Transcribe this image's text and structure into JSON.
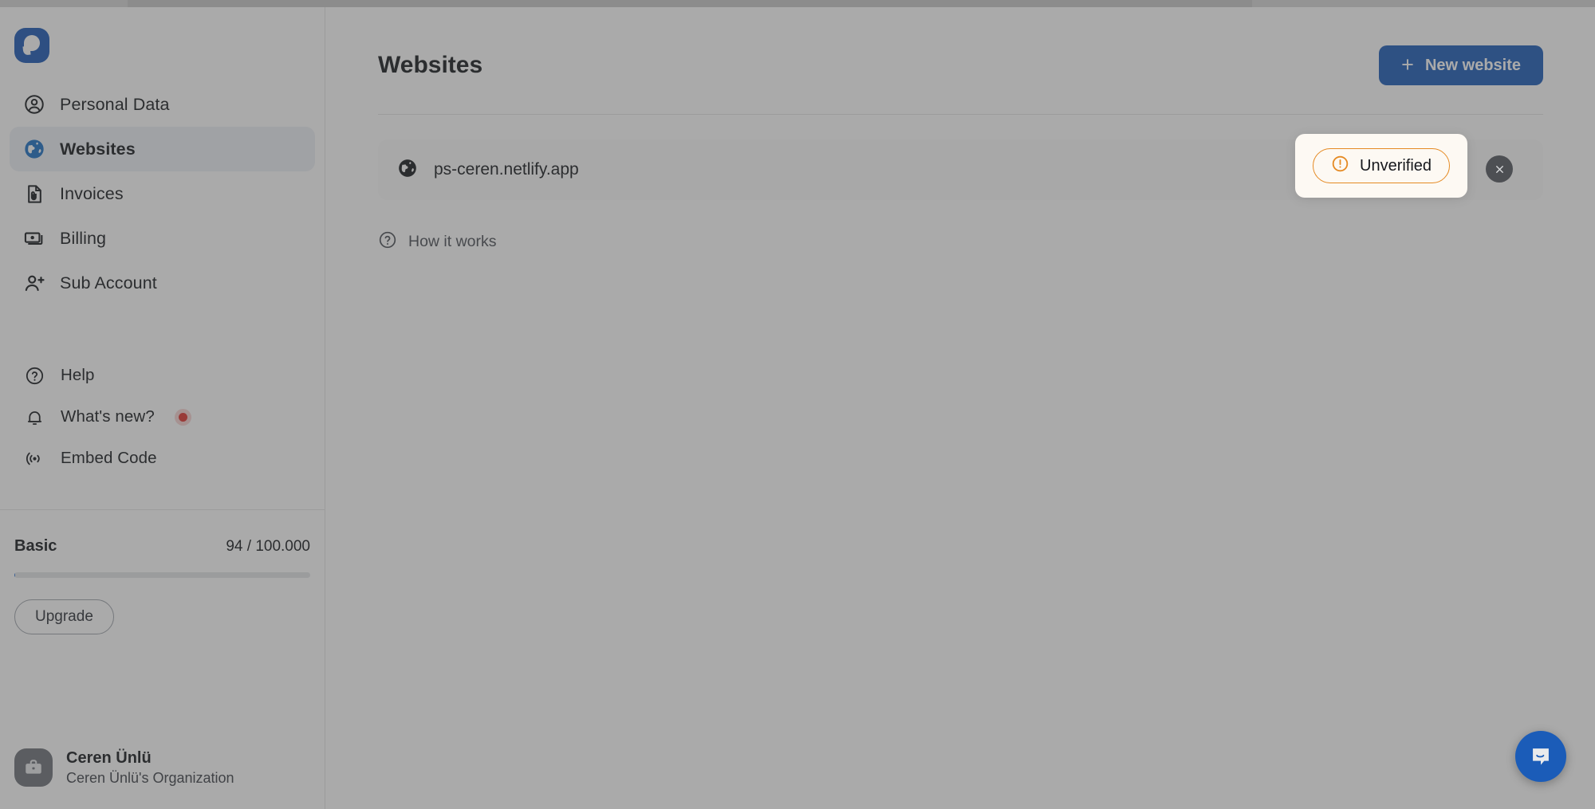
{
  "app": {
    "logo_name": "brand-logo"
  },
  "sidebar": {
    "primary_items": [
      {
        "label": "Personal Data",
        "icon": "user-circle-icon",
        "active": false
      },
      {
        "label": "Websites",
        "icon": "globe-icon",
        "active": true
      },
      {
        "label": "Invoices",
        "icon": "invoice-document-icon",
        "active": false
      },
      {
        "label": "Billing",
        "icon": "banknote-icon",
        "active": false
      },
      {
        "label": "Sub Account",
        "icon": "user-plus-icon",
        "active": false
      }
    ],
    "secondary_items": [
      {
        "label": "Help",
        "icon": "question-circle-icon",
        "badge": false
      },
      {
        "label": "What's new?",
        "icon": "bell-icon",
        "badge": true
      },
      {
        "label": "Embed Code",
        "icon": "broadcast-icon",
        "badge": false
      }
    ],
    "plan": {
      "name": "Basic",
      "usage": "94 / 100.000",
      "progress_percent": 0.094,
      "upgrade_label": "Upgrade"
    },
    "profile": {
      "name": "Ceren Ünlü",
      "organization": "Ceren Ünlü's Organization",
      "avatar_icon": "briefcase-icon"
    }
  },
  "main": {
    "title": "Websites",
    "new_website_button": {
      "label": "New website",
      "plus": "+"
    },
    "websites": [
      {
        "url": "ps-ceren.netlify.app",
        "icon": "globe-icon",
        "status": "Unverified",
        "status_icon": "alert-circle-icon",
        "close_label": "×"
      }
    ],
    "how_it_works": {
      "label": "How it works",
      "icon": "question-circle-icon"
    }
  },
  "widgets": {
    "intercom": {
      "name": "intercom-launcher",
      "icon": "chat-bubble-icon"
    }
  },
  "colors": {
    "brand_blue": "#1b5cb8",
    "accent_orange": "#e58a23",
    "notification_red": "#e0322e",
    "active_nav_bg": "#edf0f5",
    "spotlight_bg": "#fdf9f3"
  }
}
